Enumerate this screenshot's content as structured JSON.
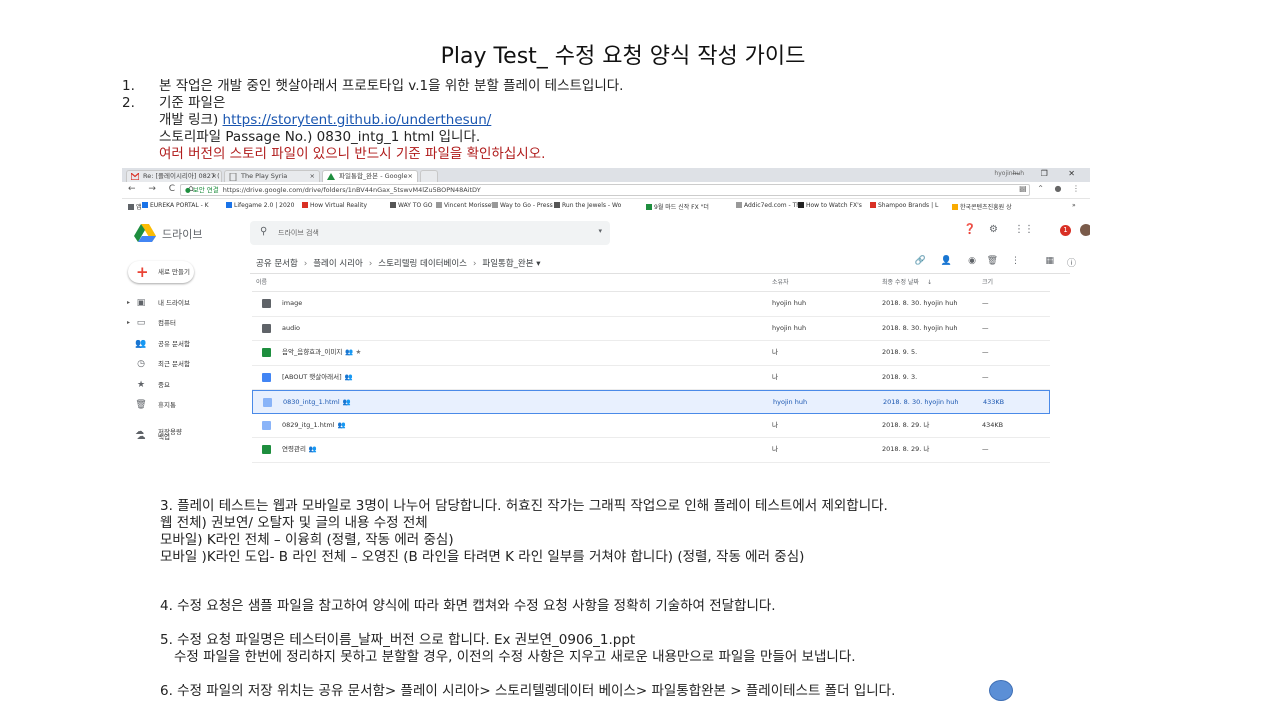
{
  "title": "Play Test_ 수정 요청 양식 작성 가이드",
  "intro": {
    "item1_num": "1.",
    "item1_text": "본 작업은 개발 중인 햇살아래서 프로토타입 v.1을 위한 분할 플레이 테스트입니다.",
    "item2_num": "2.",
    "item2_text": "기준 파일은",
    "dev_link_label": "개발 링크) ",
    "dev_link_url": "https://storytent.github.io/underthesun/",
    "story_file": "스토리파일 Passage No.) 0830_intg_1 html 입니다.",
    "warning": "여러 버전의 스토리 파일이 있으니 반드시 기준 파일을 확인하십시오."
  },
  "browser": {
    "tabs": [
      {
        "label": "Re: [플레이시리아] 0827 (",
        "icon_color": "#d93025"
      },
      {
        "label": "The Play Syria",
        "icon_color": "#9aa0a6"
      },
      {
        "label": "파일통합_완본 - Google",
        "icon_color": "#1e8e3e"
      }
    ],
    "user_chip": "hyojinhuh",
    "window_controls": "— ❐ ✕",
    "url_secure": "● 보안 연결",
    "url": "https://drive.google.com/drive/folders/1nBV44nGax_5tswvM4lZu5BOPN48AitDY",
    "bookmarks": [
      {
        "label": "앱",
        "color": "#5f6368"
      },
      {
        "label": "EUREKA PORTAL - K",
        "color": "#1a73e8"
      },
      {
        "label": "Lifegame 2.0 | 2020",
        "color": "#1a73e8"
      },
      {
        "label": "How Virtual Reality",
        "color": "#d93025"
      },
      {
        "label": "WAY TO GO",
        "color": "#555555"
      },
      {
        "label": "Vincent Morisset",
        "color": "#999999"
      },
      {
        "label": "Way to Go - Press K",
        "color": "#999999"
      },
      {
        "label": "Run the Jewels - Wo",
        "color": "#555555"
      },
      {
        "label": "9월 마드 신작 FX \"더",
        "color": "#1e8e3e"
      },
      {
        "label": "Addic7ed.com - The",
        "color": "#999999"
      },
      {
        "label": "How to Watch FX's",
        "color": "#222222"
      },
      {
        "label": "Shampoo Brands | L",
        "color": "#d93025"
      },
      {
        "label": "한국콘텐츠진흥원 상",
        "color": "#f9ab00"
      }
    ]
  },
  "drive": {
    "logo_text": "드라이브",
    "search_placeholder": "드라이브 검색",
    "new_button": "새로 만들기",
    "sidebar": [
      {
        "label": "내 드라이브",
        "icon": "drive-icon",
        "glyph": "▣",
        "arrow": "▸"
      },
      {
        "label": "컴퓨터",
        "icon": "computer-icon",
        "glyph": "▭",
        "arrow": "▸"
      },
      {
        "label": "공유 문서함",
        "icon": "shared-icon",
        "glyph": "👥",
        "arrow": ""
      },
      {
        "label": "최근 문서함",
        "icon": "clock-icon",
        "glyph": "◷",
        "arrow": ""
      },
      {
        "label": "중요",
        "icon": "star-icon",
        "glyph": "★",
        "arrow": ""
      },
      {
        "label": "휴지통",
        "icon": "trash-icon",
        "glyph": "🗑",
        "arrow": ""
      },
      {
        "label": "백업",
        "icon": "cloud-icon",
        "glyph": "☁",
        "arrow": ""
      }
    ],
    "storage_label": "저장용량",
    "breadcrumb": [
      "공유 문서함",
      "플레이 시리아",
      "스토리텔링 데이터베이스",
      "파일통합_완본"
    ],
    "breadcrumb_dropdown": "▾",
    "columns": {
      "name": "이름",
      "owner": "소유자",
      "modified": "최종 수정 날짜",
      "size": "크기",
      "sort_arrow": "↓"
    },
    "rows": [
      {
        "name": "image",
        "type": "folder",
        "shared": "",
        "owner": "hyojin huh",
        "modified": "2018. 8. 30. hyojin huh",
        "size": "—",
        "selected": false
      },
      {
        "name": "audio",
        "type": "folder",
        "shared": "",
        "owner": "hyojin huh",
        "modified": "2018. 8. 30. hyojin huh",
        "size": "—",
        "selected": false
      },
      {
        "name": "음악_음향효과_이미지",
        "type": "sheet",
        "shared": "👥 ★",
        "owner": "나",
        "modified": "2018. 9. 5.",
        "size": "—",
        "selected": false
      },
      {
        "name": "[ABOUT 햇살아래서]",
        "type": "doc",
        "shared": "👥",
        "owner": "나",
        "modified": "2018. 9. 3.",
        "size": "—",
        "selected": false
      },
      {
        "name": "0830_intg_1.html",
        "type": "file",
        "shared": "👥",
        "owner": "hyojin huh",
        "modified": "2018. 8. 30. hyojin huh",
        "size": "433KB",
        "selected": true
      },
      {
        "name": "0829_itg_1.html",
        "type": "file",
        "shared": "👥",
        "owner": "나",
        "modified": "2018. 8. 29. 나",
        "size": "434KB",
        "selected": false
      },
      {
        "name": "연령관리",
        "type": "sheet",
        "shared": "👥",
        "owner": "나",
        "modified": "2018. 8. 29. 나",
        "size": "—",
        "selected": false
      }
    ]
  },
  "section3": {
    "line1": "3. 플레이 테스트는 웹과 모바일로 3명이 나누어 담당합니다.  허효진 작가는 그래픽 작업으로 인해 플레이 테스트에서 제외합니다.",
    "line2": "웹 전체) 권보연/ 오탈자 및 글의 내용 수정 전체",
    "line3": "모바일) K라인 전체 – 이융희 (정렬, 작동 에러 중심)",
    "line4": "모바일 )K라인 도입- B 라인 전체 – 오영진 (B 라인을 타려면 K 라인 일부를 거쳐야 합니다) (정렬, 작동 에러 중심)"
  },
  "section4": "4. 수정 요청은 샘플 파일을 참고하여 양식에 따라 화면 캡쳐와 수정 요청 사항을 정확히 기술하여 전달합니다.",
  "section5": {
    "line1": "5. 수정 요청 파일명은 테스터이름_날짜_버전 으로 합니다. Ex 권보연_0906_1.ppt",
    "line2": "수정 파일을 한번에 정리하지 못하고 분할할 경우, 이전의 수정 사항은 지우고 새로운 내용만으로 파일을 만들어 보냅니다."
  },
  "section6": "6. 수정 파일의 저장 위치는 공유 문서함> 플레이 시리아> 스토리텔렝데이터 베이스> 파일통합완본 > 플레이테스트 폴더 입니다."
}
